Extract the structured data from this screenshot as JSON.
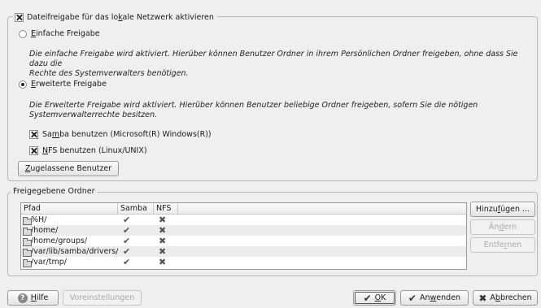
{
  "top": {
    "enable_label_pre": "Dateifreigabe für das lo",
    "enable_label_u": "k",
    "enable_label_post": "ale Netzwerk aktivieren",
    "simple_pre": "",
    "simple_u": "E",
    "simple_post": "infache Freigabe",
    "simple_desc_1": "Die einfache Freigabe wird aktiviert. Hierüber können Benutzer Ordner in ihrem Persönlichen Ordner freigeben, ohne dass Sie dazu die",
    "simple_desc_2": "Rechte des Systemverwalters benötigen.",
    "advanced_pre": "",
    "advanced_u": "E",
    "advanced_post": "rweiterte Freigabe",
    "advanced_desc_1": "Die Erweiterte Freigabe wird aktiviert. Hierüber können Benutzer beliebige Ordner freigeben, sofern Sie die nötigen",
    "advanced_desc_2": "Systemverwalterrechte besitzen.",
    "samba_pre": "Sa",
    "samba_u": "m",
    "samba_post": "ba benutzen (Microsoft(R) Windows(R))",
    "nfs_pre": "",
    "nfs_u": "N",
    "nfs_post": "FS benutzen (Linux/UNIX)",
    "allowed_users_pre": "",
    "allowed_users_u": "Z",
    "allowed_users_post": "ugelassene Benutzer"
  },
  "shared": {
    "title": "Freigegebene Ordner",
    "columns": [
      "Pfad",
      "Samba",
      "NFS"
    ],
    "rows": [
      {
        "path": "%H/",
        "samba": "✔",
        "nfs": "✖"
      },
      {
        "path": "/home/",
        "samba": "✔",
        "nfs": "✖"
      },
      {
        "path": "/home/groups/",
        "samba": "✔",
        "nfs": "✖"
      },
      {
        "path": "/var/lib/samba/drivers/",
        "samba": "✔",
        "nfs": "✖"
      },
      {
        "path": "/var/tmp/",
        "samba": "✔",
        "nfs": "✖"
      }
    ],
    "add_pre": "Hinzu",
    "add_u": "f",
    "add_post": "ügen ...",
    "change_pre": "Än",
    "change_u": "d",
    "change_post": "ern",
    "remove_pre": "Entfe",
    "remove_u": "r",
    "remove_post": "nen"
  },
  "footer": {
    "help_u": "H",
    "help_post": "ilfe",
    "defaults": "Voreinstellungen",
    "ok_u": "O",
    "ok_post": "K",
    "apply_pre": "An",
    "apply_u": "w",
    "apply_post": "enden",
    "cancel_pre": "A",
    "cancel_u": "b",
    "cancel_post": "brechen"
  },
  "icons": {
    "check_mark": "✔",
    "cross_mark": "✖",
    "help": "?"
  }
}
